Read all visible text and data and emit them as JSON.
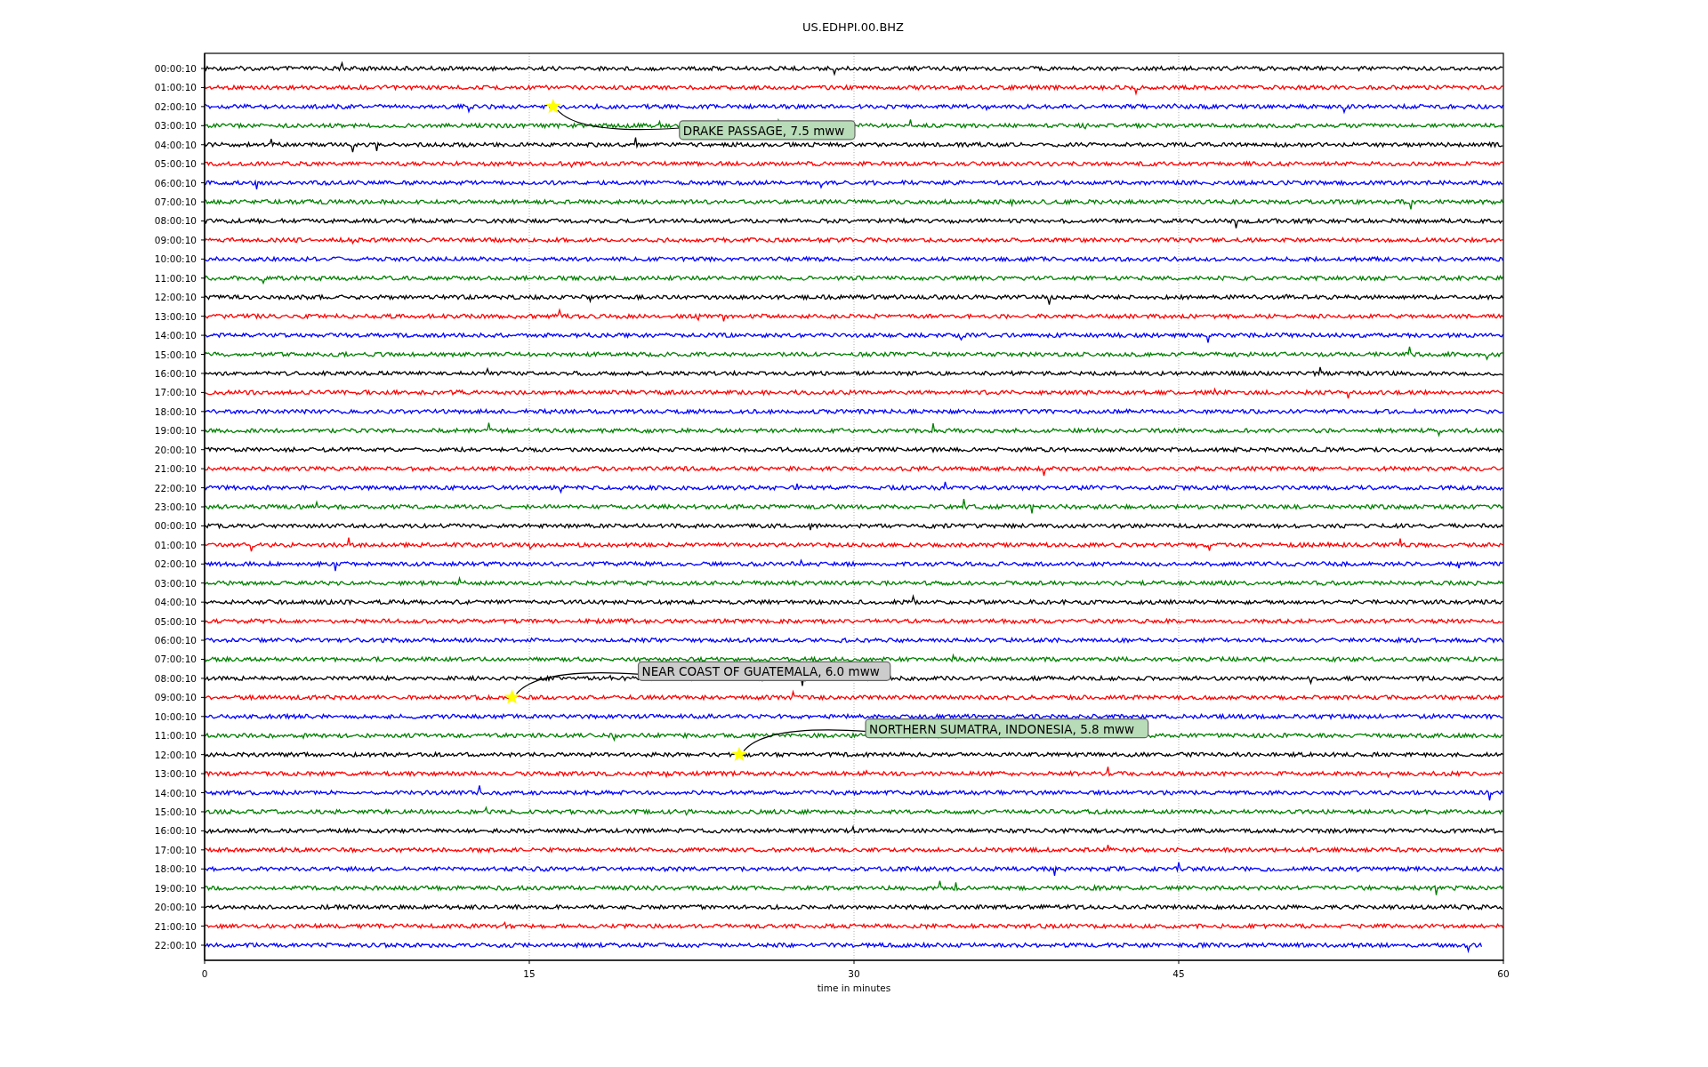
{
  "plot": {
    "title": "US.EDHPI.00.BHZ",
    "xlabel": "time in minutes",
    "xticks": [
      "0",
      "15",
      "30",
      "45",
      "60"
    ],
    "rows": [
      {
        "label": "00:00:10",
        "color": "#000000"
      },
      {
        "label": "01:00:10",
        "color": "#ff0000"
      },
      {
        "label": "02:00:10",
        "color": "#0000ff",
        "event": {
          "label": "DRAKE PASSAGE, 7.5 mww",
          "color": "#b8dcb8"
        }
      },
      {
        "label": "03:00:10",
        "color": "#008000"
      },
      {
        "label": "04:00:10",
        "color": "#000000"
      },
      {
        "label": "05:00:10",
        "color": "#ff0000"
      },
      {
        "label": "06:00:10",
        "color": "#0000ff"
      },
      {
        "label": "07:00:10",
        "color": "#008000"
      },
      {
        "label": "08:00:10",
        "color": "#000000"
      },
      {
        "label": "09:00:10",
        "color": "#ff0000"
      },
      {
        "label": "10:00:10",
        "color": "#0000ff"
      },
      {
        "label": "11:00:10",
        "color": "#008000"
      },
      {
        "label": "12:00:10",
        "color": "#000000"
      },
      {
        "label": "13:00:10",
        "color": "#ff0000"
      },
      {
        "label": "14:00:10",
        "color": "#0000ff"
      },
      {
        "label": "15:00:10",
        "color": "#008000"
      },
      {
        "label": "16:00:10",
        "color": "#000000"
      },
      {
        "label": "17:00:10",
        "color": "#ff0000"
      },
      {
        "label": "18:00:10",
        "color": "#0000ff"
      },
      {
        "label": "19:00:10",
        "color": "#008000"
      },
      {
        "label": "20:00:10",
        "color": "#000000"
      },
      {
        "label": "21:00:10",
        "color": "#ff0000"
      },
      {
        "label": "22:00:10",
        "color": "#0000ff"
      },
      {
        "label": "23:00:10",
        "color": "#008000"
      },
      {
        "label": "00:00:10",
        "color": "#000000"
      },
      {
        "label": "01:00:10",
        "color": "#ff0000"
      },
      {
        "label": "02:00:10",
        "color": "#0000ff"
      },
      {
        "label": "03:00:10",
        "color": "#008000"
      },
      {
        "label": "04:00:10",
        "color": "#000000"
      },
      {
        "label": "05:00:10",
        "color": "#ff0000"
      },
      {
        "label": "06:00:10",
        "color": "#0000ff"
      },
      {
        "label": "07:00:10",
        "color": "#008000"
      },
      {
        "label": "08:00:10",
        "color": "#000000"
      },
      {
        "label": "09:00:10",
        "color": "#ff0000",
        "event": {
          "label": "NEAR COAST OF GUATEMALA, 6.0 mww",
          "color": "#cccccc"
        }
      },
      {
        "label": "10:00:10",
        "color": "#0000ff"
      },
      {
        "label": "11:00:10",
        "color": "#008000"
      },
      {
        "label": "12:00:10",
        "color": "#000000",
        "event": {
          "label": "NORTHERN SUMATRA, INDONESIA, 5.8 mww",
          "color": "#b8dcb8"
        }
      },
      {
        "label": "13:00:10",
        "color": "#ff0000"
      },
      {
        "label": "14:00:10",
        "color": "#0000ff"
      },
      {
        "label": "15:00:10",
        "color": "#008000"
      },
      {
        "label": "16:00:10",
        "color": "#000000"
      },
      {
        "label": "17:00:10",
        "color": "#ff0000"
      },
      {
        "label": "18:00:10",
        "color": "#0000ff"
      },
      {
        "label": "19:00:10",
        "color": "#008000"
      },
      {
        "label": "20:00:10",
        "color": "#000000"
      },
      {
        "label": "21:00:10",
        "color": "#ff0000"
      },
      {
        "label": "22:00:10",
        "color": "#0000ff"
      }
    ]
  }
}
